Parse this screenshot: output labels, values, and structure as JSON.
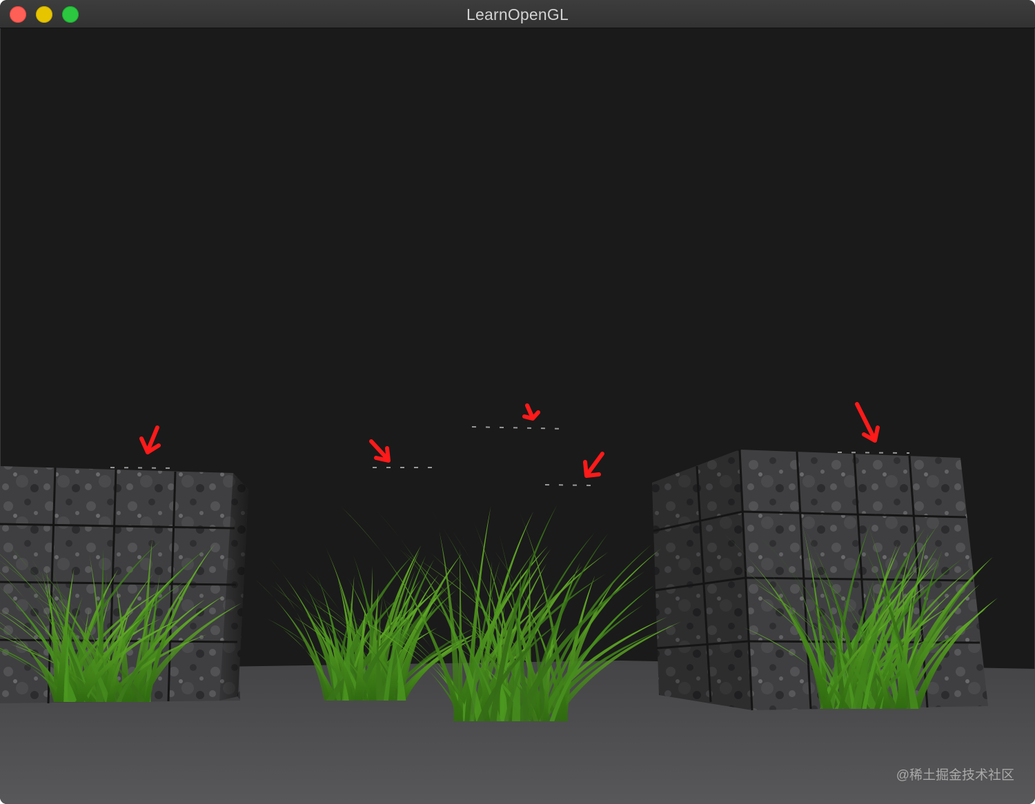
{
  "window": {
    "title": "LearnOpenGL"
  },
  "scene": {
    "background_color": "#1a1a1a",
    "floor_color": "#4a4a4c",
    "marker_color": "#ff1a1a",
    "grass_color": "#4e9a1c"
  },
  "watermark": {
    "text": "@稀土掘金技术社区"
  },
  "icons": {
    "close": "close-icon",
    "minimize": "minimize-icon",
    "zoom": "zoom-icon",
    "arrow": "red-arrow-icon"
  }
}
